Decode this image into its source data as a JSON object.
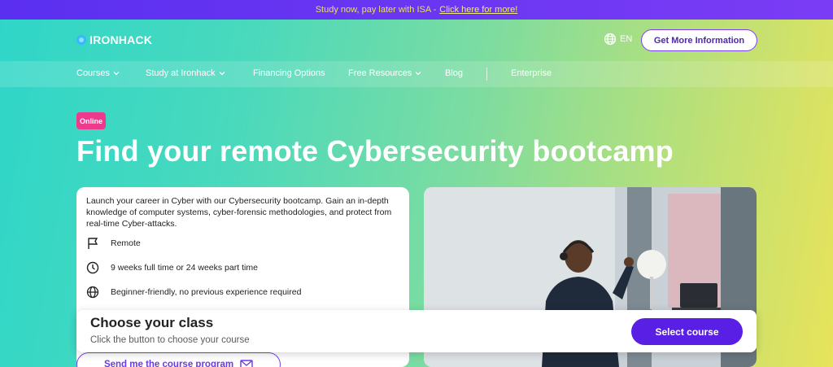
{
  "promo": {
    "text": "Study now, pay later with ISA - ",
    "link": "Click here for more!"
  },
  "header": {
    "logo": "IRONHACK",
    "language": "EN",
    "cta": "Get More Information"
  },
  "nav": {
    "items": [
      {
        "label": "Courses",
        "has_dropdown": true
      },
      {
        "label": "Study at Ironhack",
        "has_dropdown": true
      },
      {
        "label": "Financing Options",
        "has_dropdown": false
      },
      {
        "label": "Free Resources",
        "has_dropdown": true
      },
      {
        "label": "Blog",
        "has_dropdown": false
      },
      {
        "label": "Enterprise",
        "has_dropdown": false
      }
    ]
  },
  "hero": {
    "badge": "Online",
    "title": "Find your remote Cybersecurity bootcamp",
    "description": "Launch your career in Cyber with our Cybersecurity bootcamp. Gain an in-depth knowledge of computer systems, cyber-forensic methodologies, and protect from real-time Cyber-attacks.",
    "features": [
      {
        "icon": "flag-icon",
        "text": "Remote"
      },
      {
        "icon": "clock-icon",
        "text": "9 weeks full time or 24 weeks part time"
      },
      {
        "icon": "globe-icon",
        "text": "Beginner-friendly, no previous experience required"
      }
    ]
  },
  "choose_class": {
    "title": "Choose your class",
    "subtitle": "Click the button to choose your course",
    "button": "Select course"
  },
  "send_program": {
    "button": "Send me the course program"
  },
  "colors": {
    "promo_bg": "#5b2ff0",
    "accent_purple": "#5a1fe5",
    "badge_pink": "#ee3a8c",
    "gradient_start": "#2fd6c8",
    "gradient_end": "#e8e35a"
  }
}
